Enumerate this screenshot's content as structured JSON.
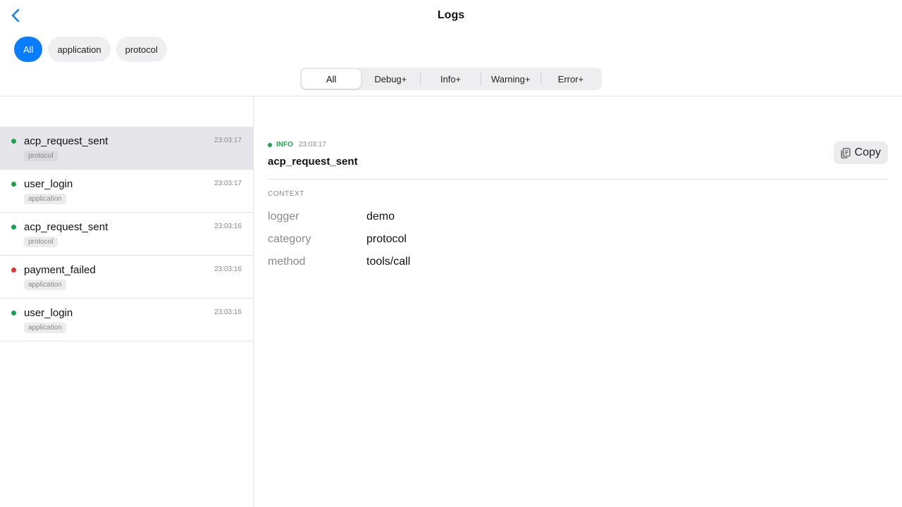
{
  "header": {
    "title": "Logs"
  },
  "categories": [
    {
      "label": "All",
      "active": true
    },
    {
      "label": "application",
      "active": false
    },
    {
      "label": "protocol",
      "active": false
    }
  ],
  "levels": [
    {
      "label": "All",
      "active": true
    },
    {
      "label": "Debug+",
      "active": false
    },
    {
      "label": "Info+",
      "active": false
    },
    {
      "label": "Warning+",
      "active": false
    },
    {
      "label": "Error+",
      "active": false
    }
  ],
  "entries": [
    {
      "name": "acp_request_sent",
      "time": "23:03:17",
      "tag": "protocol",
      "status": "info",
      "selected": true
    },
    {
      "name": "user_login",
      "time": "23:03:17",
      "tag": "application",
      "status": "info",
      "selected": false
    },
    {
      "name": "acp_request_sent",
      "time": "23:03:16",
      "tag": "protocol",
      "status": "info",
      "selected": false
    },
    {
      "name": "payment_failed",
      "time": "23:03:16",
      "tag": "application",
      "status": "error",
      "selected": false
    },
    {
      "name": "user_login",
      "time": "23:03:16",
      "tag": "application",
      "status": "info",
      "selected": false
    }
  ],
  "detail": {
    "level": "INFO",
    "time": "23:03:17",
    "name": "acp_request_sent",
    "copy_label": "Copy",
    "context_label": "CONTEXT",
    "context": [
      {
        "key": "logger",
        "value": "demo"
      },
      {
        "key": "category",
        "value": "protocol"
      },
      {
        "key": "method",
        "value": "tools/call"
      }
    ]
  },
  "colors": {
    "accent": "#0a7cff",
    "info": "#1aa34a",
    "error": "#e0312f"
  },
  "icons": {
    "back": "chevron-left-icon",
    "copy": "copy-icon"
  }
}
